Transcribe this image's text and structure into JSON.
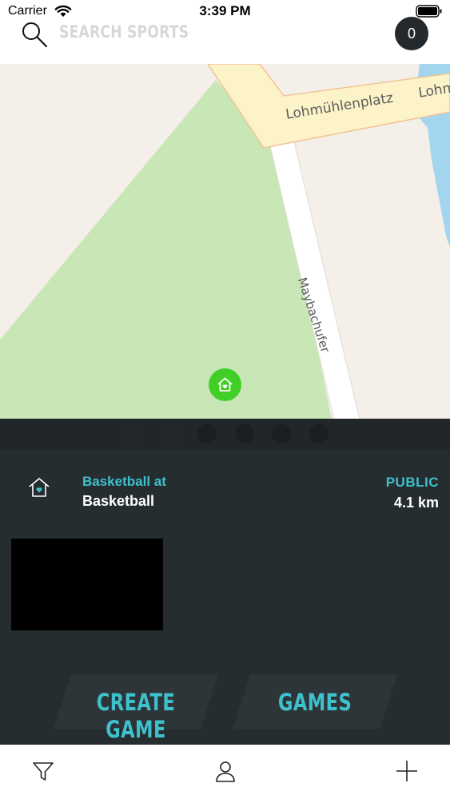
{
  "status_bar": {
    "carrier": "Carrier",
    "time": "3:39 PM"
  },
  "header": {
    "search_placeholder": "SEARCH SPORTS",
    "badge_count": "0"
  },
  "map": {
    "labels": {
      "street_1": "Lohmühlenplatz",
      "street_1_cut": "Lohm",
      "street_2": "Maybachufer"
    }
  },
  "venue": {
    "sport": "Basketball at",
    "name": "Basketball",
    "visibility": "PUBLIC",
    "distance": "4.1 km"
  },
  "actions": {
    "create_game": "CREATE GAME",
    "games": "GAMES"
  },
  "icons": {
    "search": "search-icon",
    "wifi": "wifi-icon",
    "battery": "battery-icon",
    "map_pin": "home-pin-icon",
    "venue": "home-icon",
    "filter": "filter-icon",
    "profile": "profile-icon",
    "add": "plus-icon"
  },
  "colors": {
    "accent": "#3ec1cc",
    "panel": "#262d31",
    "pin": "#41cf27",
    "park": "#c9e7b6",
    "water": "#a3d6ee"
  }
}
